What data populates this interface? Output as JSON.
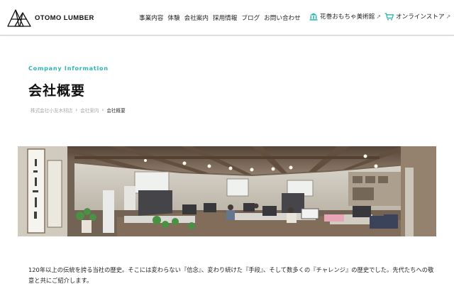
{
  "brand": {
    "name": "OTOMO LUMBER"
  },
  "nav": {
    "items": [
      {
        "id": "business",
        "label": "事業内容"
      },
      {
        "id": "experience",
        "label": "体験"
      },
      {
        "id": "company",
        "label": "会社案内"
      },
      {
        "id": "recruit",
        "label": "採用情報"
      },
      {
        "id": "blog",
        "label": "ブログ"
      },
      {
        "id": "contact",
        "label": "お問い合わせ"
      }
    ],
    "museum_label": "花巻おもちゃ美術館",
    "store_label": "オンラインストア",
    "museum_icon": "museum-icon",
    "store_icon": "cart-icon",
    "accent": "#2bb5b2"
  },
  "hero": {
    "eyebrow": "Company Information",
    "title": "会社概要"
  },
  "breadcrumb": {
    "items": [
      "株式会社小友木材店",
      "会社案内",
      "会社概要"
    ]
  },
  "intro": {
    "text": "120年以上の伝統を誇る当社の歴史。そこには変わらない『信念』、変わり続けた『手段』、そして数多くの『チャレンジ』の歴史でした。先代たちへの敬意と共にご紹介します。"
  }
}
